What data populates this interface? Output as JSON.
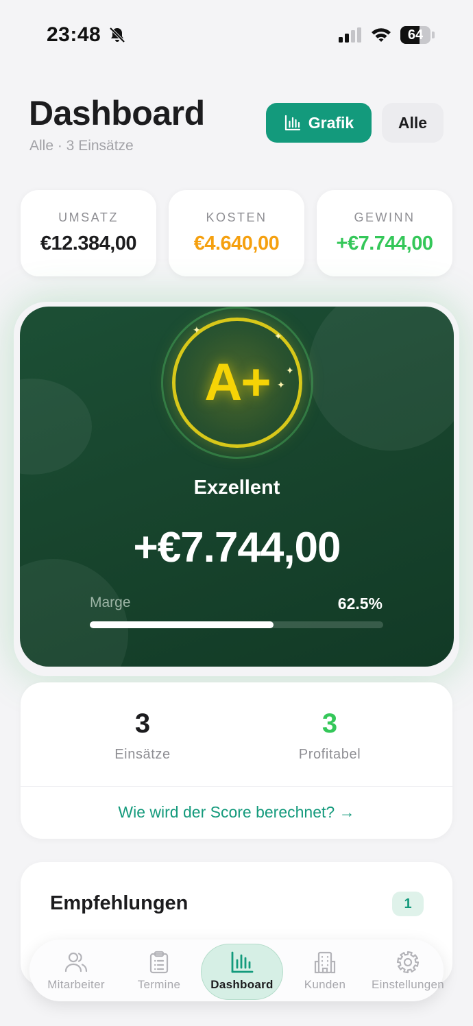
{
  "status_bar": {
    "time": "23:48",
    "battery": "64",
    "battery_level": 0.64
  },
  "header": {
    "title": "Dashboard",
    "subtitle": "Alle · 3 Einsätze",
    "grafik_button": "Grafik",
    "filter_button": "Alle"
  },
  "stats": [
    {
      "label": "UMSATZ",
      "value": "€12.384,00",
      "color": "#1c1c1e"
    },
    {
      "label": "KOSTEN",
      "value": "€4.640,00",
      "color": "#f5a00f"
    },
    {
      "label": "GEWINN",
      "value": "+€7.744,00",
      "color": "#34c759"
    }
  ],
  "score": {
    "grade": "A+",
    "rating": "Exzellent",
    "amount": "+€7.744,00",
    "margin_label": "Marge",
    "margin_value": "62.5%",
    "margin_fraction": 0.625,
    "accent_color": "#f6d406"
  },
  "counts": {
    "einsaetze_value": "3",
    "einsaetze_label": "Einsätze",
    "profitabel_value": "3",
    "profitabel_label": "Profitabel",
    "profitabel_color": "#34c759",
    "link": "Wie wird der Score berechnet? →"
  },
  "recommendations": {
    "title": "Empfehlungen",
    "count": "1"
  },
  "tabs": [
    {
      "label": "Mitarbeiter",
      "icon": "users-icon"
    },
    {
      "label": "Termine",
      "icon": "clipboard-icon"
    },
    {
      "label": "Dashboard",
      "icon": "bar-chart-icon",
      "active": true
    },
    {
      "label": "Kunden",
      "icon": "building-icon"
    },
    {
      "label": "Einstellungen",
      "icon": "gear-icon"
    }
  ],
  "colors": {
    "brand": "#139a7c",
    "card_dark": "#17432c"
  }
}
